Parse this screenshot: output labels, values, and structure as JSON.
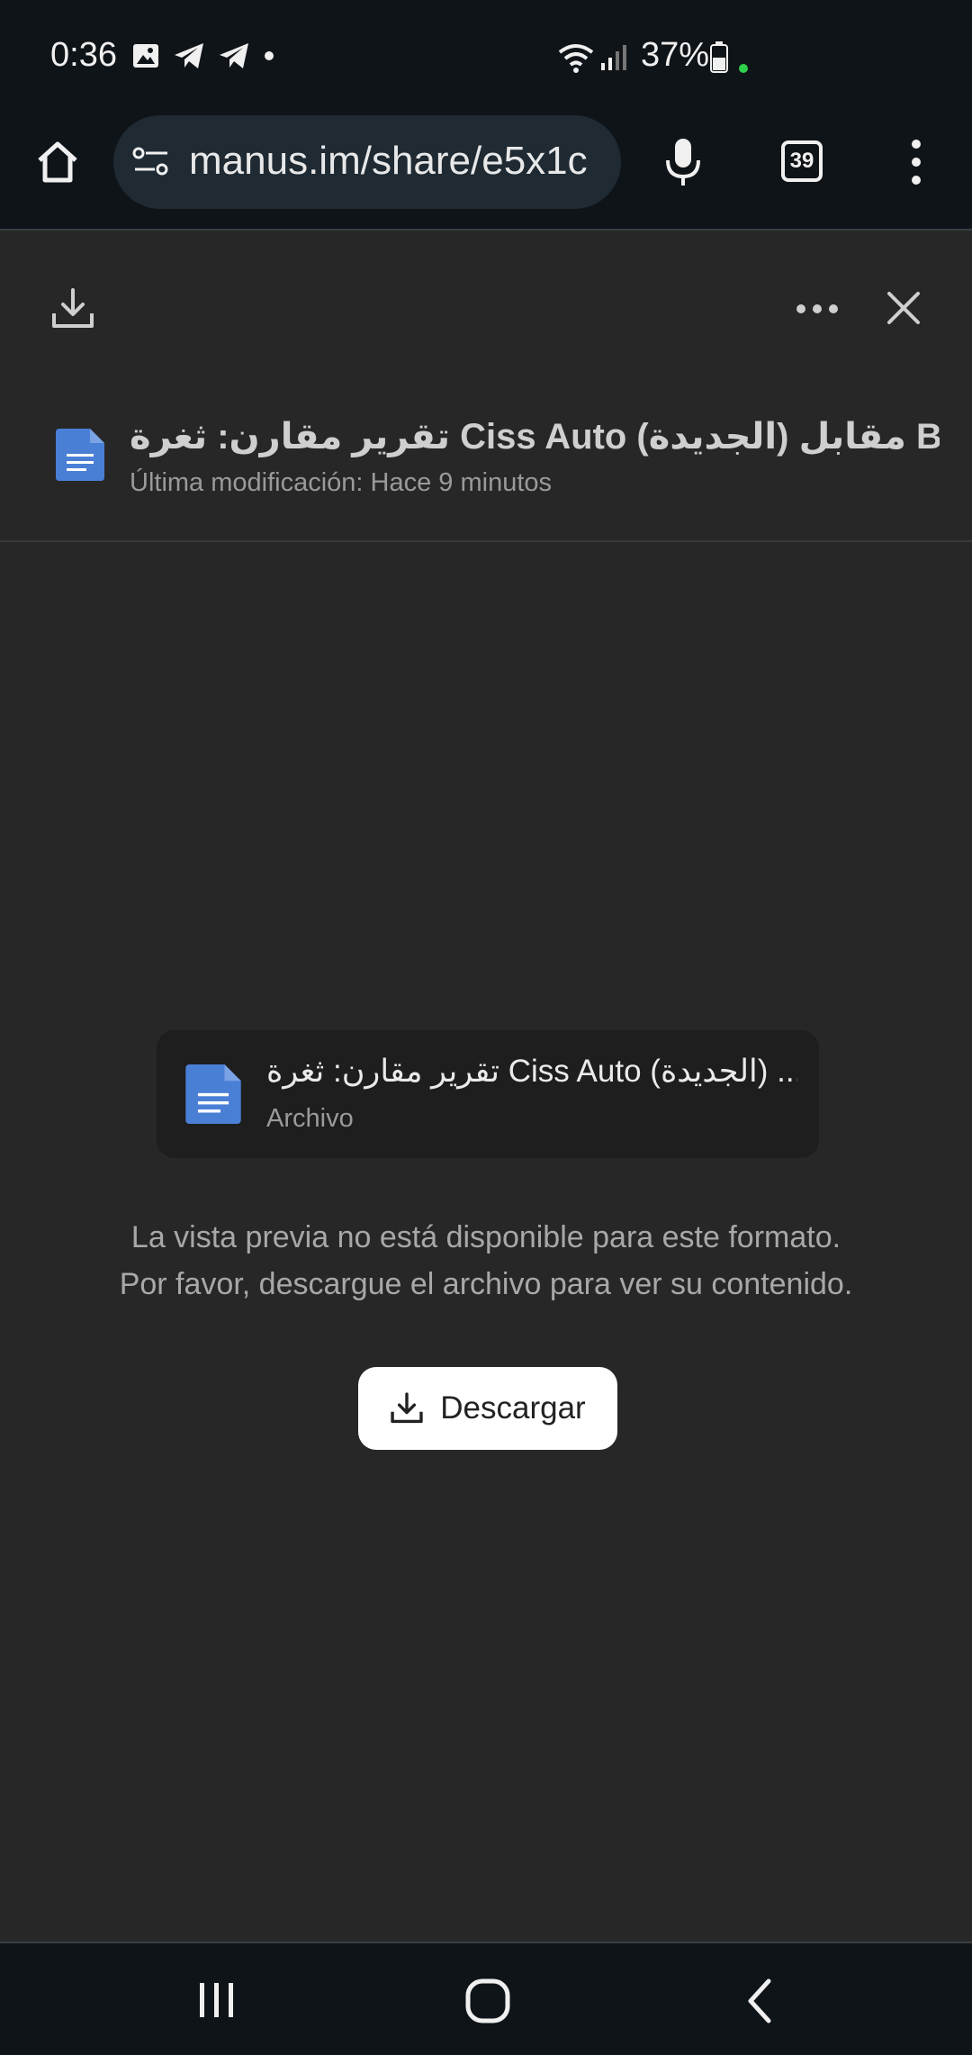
{
  "status_bar": {
    "time": "0:36",
    "battery": "37%",
    "icons_left": [
      "gallery-icon",
      "telegram-icon",
      "telegram-icon",
      "dot-icon"
    ],
    "icons_right": [
      "wifi-icon",
      "signal-icon",
      "battery-icon",
      "green-dot"
    ]
  },
  "browser": {
    "url": "manus.im/share/e5x1c",
    "tab_count": "39"
  },
  "viewer": {
    "file_title": "تقرير مقارن: ثغرة Ciss Auto (الجديدة) مقابل BADERL...",
    "modified": "Última modificación: Hace 9 minutos"
  },
  "card": {
    "title": "تقرير مقارن: ثغرة Ciss Auto (الجديدة) ...ل",
    "subtitle": "Archivo"
  },
  "message": {
    "line1": "La vista previa no está disponible para este formato.",
    "line2": "Por favor, descargue el archivo para ver su contenido."
  },
  "download_label": "Descargar",
  "colors": {
    "background": "#272727",
    "bar": "#0f1419",
    "doc_icon": "#4a7fd6",
    "accent_dot": "#2fd04a"
  }
}
